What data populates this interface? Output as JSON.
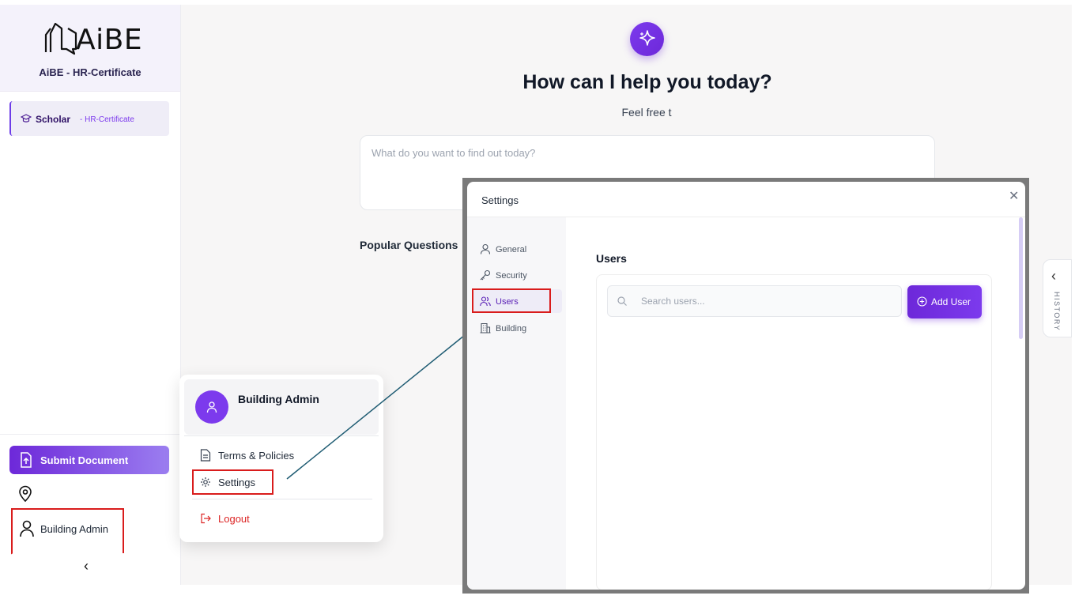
{
  "brand": {
    "logo_text": "AiBE",
    "subtitle": "AiBE - HR-Certificate"
  },
  "sidebar": {
    "project": {
      "name": "Scholar",
      "tag": "- HR-Certificate",
      "icon": "graduation-cap-icon"
    },
    "submit_label": "Submit Document",
    "user_label": "Building Admin",
    "collapse_icon": "chevron-left-icon"
  },
  "main": {
    "title": "How can I help you today?",
    "subtitle": "Feel free t",
    "query_placeholder": "What do you want to find out today?",
    "popular_title": "Popular Questions",
    "history_label": "HISTORY"
  },
  "user_menu": {
    "name": "Building Admin",
    "items": [
      {
        "label": "Terms & Policies",
        "icon": "document-icon"
      },
      {
        "label": "Settings",
        "icon": "gear-icon"
      }
    ],
    "logout_label": "Logout"
  },
  "settings_modal": {
    "title": "Settings",
    "nav": [
      {
        "label": "General",
        "icon": "user-icon"
      },
      {
        "label": "Security",
        "icon": "key-icon"
      },
      {
        "label": "Users",
        "icon": "users-icon",
        "active": true
      },
      {
        "label": "Building",
        "icon": "building-icon"
      }
    ],
    "section_title": "Users",
    "search_placeholder": "Search users...",
    "add_user_label": "Add User"
  },
  "colors": {
    "accent": "#6d28d9",
    "highlight": "#d91c1c",
    "logout": "#dc2626"
  }
}
